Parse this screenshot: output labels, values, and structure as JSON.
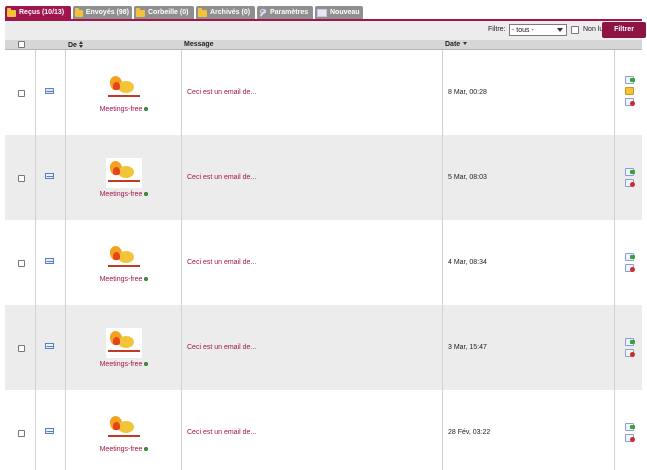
{
  "tabs": [
    {
      "label": "Reçus (10/13)",
      "icon": "folder-icon",
      "active": true
    },
    {
      "label": "Envoyés (98)",
      "icon": "folder-icon",
      "active": false
    },
    {
      "label": "Corbeille (0)",
      "icon": "folder-icon",
      "active": false
    },
    {
      "label": "Archivés (0)",
      "icon": "folder-icon",
      "active": false
    },
    {
      "label": "Paramètres",
      "icon": "wrench-icon",
      "active": false
    },
    {
      "label": "Nouveau",
      "icon": "new-mail-icon",
      "active": false
    }
  ],
  "filter": {
    "label": "Filtre:",
    "selected": "- tous -",
    "unread_label": "Non lu",
    "button_label": "Filtrer"
  },
  "columns": {
    "from": "De",
    "message": "Message",
    "date": "Date"
  },
  "messages": [
    {
      "sender": "Meetings-free",
      "preview": "Ceci est un email de...",
      "date": "8 Mar, 00:28",
      "read": true
    },
    {
      "sender": "Meetings-free",
      "preview": "Ceci est un email de...",
      "date": "5 Mar, 08:03",
      "read": false
    },
    {
      "sender": "Meetings-free",
      "preview": "Ceci est un email de...",
      "date": "4 Mar, 08:34",
      "read": false
    },
    {
      "sender": "Meetings-free",
      "preview": "Ceci est un email de...",
      "date": "3 Mar, 15:47",
      "read": false
    },
    {
      "sender": "Meetings-free",
      "preview": "Ceci est un email de...",
      "date": "28 Fév, 03:22",
      "read": false
    }
  ],
  "colors": {
    "accent": "#a0154e",
    "tab_inactive": "#8f8f8f",
    "row_alt": "#ececec"
  }
}
